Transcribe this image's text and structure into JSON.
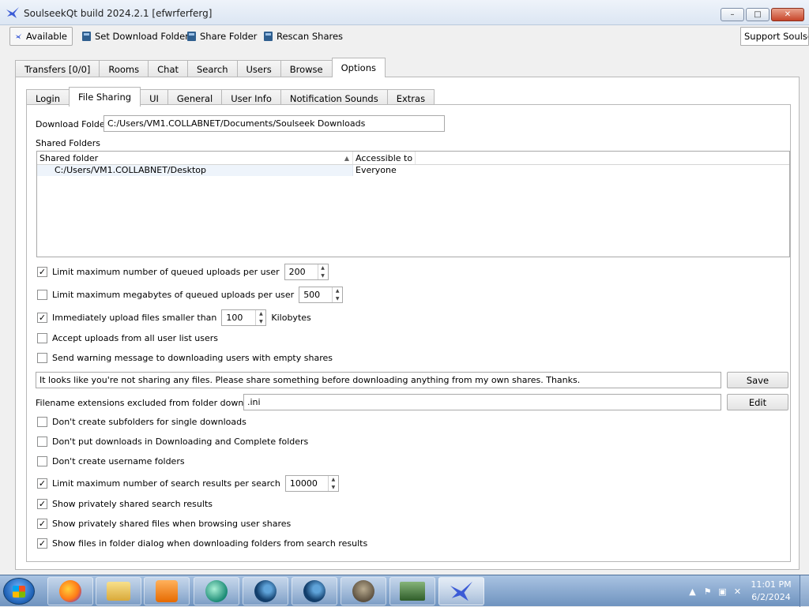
{
  "window": {
    "title": "SoulseekQt build 2024.2.1 [efwrferferg]",
    "minimize": "–",
    "maximize": "□",
    "close": "✕"
  },
  "toolbar": {
    "available": "Available",
    "set_download_folder": "Set Download Folder",
    "share_folder": "Share Folder",
    "rescan_shares": "Rescan Shares",
    "support": "Support Soulseek"
  },
  "main_tabs": [
    "Transfers [0/0]",
    "Rooms",
    "Chat",
    "Search",
    "Users",
    "Browse",
    "Options"
  ],
  "sub_tabs": [
    "Login",
    "File Sharing",
    "UI",
    "General",
    "User Info",
    "Notification Sounds",
    "Extras"
  ],
  "file_sharing": {
    "download_folder_label": "Download Folder",
    "download_folder_value": "C:/Users/VM1.COLLABNET/Documents/Soulseek Downloads",
    "shared_folders_label": "Shared Folders",
    "table": {
      "col_folder": "Shared folder",
      "col_access": "Accessible to",
      "rows": [
        {
          "folder": "C:/Users/VM1.COLLABNET/Desktop",
          "access": "Everyone"
        }
      ]
    },
    "limit_queued_uploads": {
      "label": "Limit maximum number of queued uploads per user",
      "checked": true,
      "value": "200"
    },
    "limit_queued_megabytes": {
      "label": "Limit maximum megabytes of queued uploads per user",
      "checked": false,
      "value": "500"
    },
    "immediate_upload": {
      "label": "Immediately upload files smaller than",
      "checked": true,
      "value": "100",
      "unit": "Kilobytes"
    },
    "accept_from_user_list": {
      "label": "Accept uploads from all user list users",
      "checked": false
    },
    "send_warning_message": {
      "label": "Send warning message to downloading users with empty shares",
      "checked": false
    },
    "warning_message": "It looks like you're not sharing any files. Please share something before downloading anything from my own shares. Thanks.",
    "save_button": "Save",
    "excluded_ext_label": "Filename extensions excluded from folder downloads:",
    "excluded_ext_value": ".ini",
    "edit_button": "Edit",
    "no_subfolders": {
      "label": "Don't create subfolders for single downloads",
      "checked": false
    },
    "no_downloading_folders": {
      "label": "Don't put downloads in Downloading and Complete folders",
      "checked": false
    },
    "no_username_folders": {
      "label": "Don't create username folders",
      "checked": false
    },
    "limit_search_results": {
      "label": "Limit maximum number of search results per search",
      "checked": true,
      "value": "10000"
    },
    "show_private_search": {
      "label": "Show privately shared search results",
      "checked": true
    },
    "show_private_browse": {
      "label": "Show privately shared files when browsing user shares",
      "checked": true
    },
    "show_folder_dialog": {
      "label": "Show files in folder dialog when downloading folders from search results",
      "checked": true
    }
  },
  "taskbar": {
    "time": "11:01 PM",
    "date": "6/2/2024"
  }
}
